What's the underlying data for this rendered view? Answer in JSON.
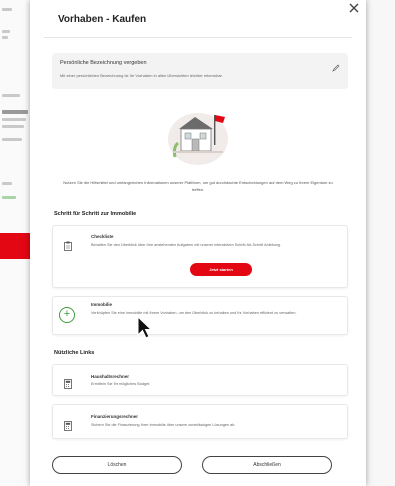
{
  "modal": {
    "title": "Vorhaben - Kaufen",
    "close_icon": "close-icon"
  },
  "name_box": {
    "title": "Persönliche Bezeichnung vergeben",
    "description": "Mit einer persönlichen Bezeichnung ist Ihr Vorhaben in allen Übersichten leichter erkennbar."
  },
  "intro_text": "Nutzen Sie die Hilfsmittel und umfangreichen Informationen unserer Plattform, um gut durchdachte Entscheidungen auf dem Weg zu Ihrem Eigentum zu treffen.",
  "step_section": {
    "heading": "Schritt für Schritt zur Immobilie",
    "checklist": {
      "title": "Checkliste",
      "description": "Behalten Sie den Überblick über Ihre anstehenden Aufgaben mit unserer interaktiven Schritt-für-Schritt Anleitung.",
      "button": "Jetzt starten"
    },
    "property": {
      "title": "Immobilie",
      "description": "Verknüpfen Sie eine Immobilie mit Ihrem Vorhaben, um den Überblick zu behalten und Ihr Vorhaben effizient zu verwalten."
    }
  },
  "links_section": {
    "heading": "Nützliche Links",
    "items": [
      {
        "title": "Haushaltsrechner",
        "description": "Ermitteln Sie Ihr mögliches Budget."
      },
      {
        "title": "Finanzierungsrechner",
        "description": "Sichern Sie die Finanzierung Ihrer Immobilie über unsere zuverlässigen Lösungen ab."
      }
    ]
  },
  "footer": {
    "delete": "Löschen",
    "finish": "Abschließen"
  },
  "colors": {
    "accent": "#e30613",
    "success": "#3e9a3e"
  }
}
